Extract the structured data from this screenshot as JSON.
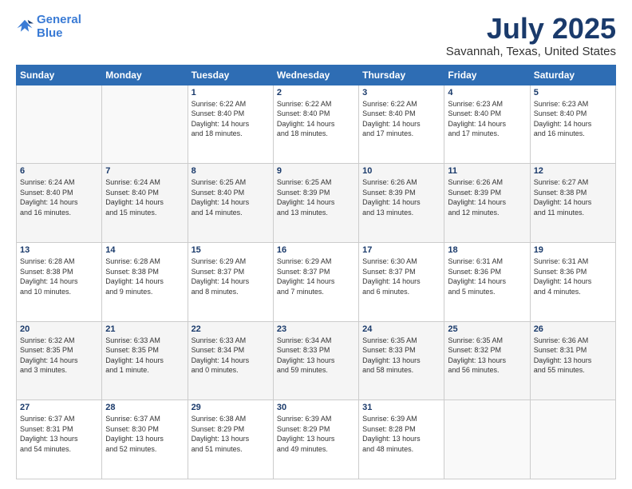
{
  "logo": {
    "line1": "General",
    "line2": "Blue"
  },
  "title": "July 2025",
  "subtitle": "Savannah, Texas, United States",
  "days_header": [
    "Sunday",
    "Monday",
    "Tuesday",
    "Wednesday",
    "Thursday",
    "Friday",
    "Saturday"
  ],
  "weeks": [
    [
      {
        "num": "",
        "info": ""
      },
      {
        "num": "",
        "info": ""
      },
      {
        "num": "1",
        "info": "Sunrise: 6:22 AM\nSunset: 8:40 PM\nDaylight: 14 hours\nand 18 minutes."
      },
      {
        "num": "2",
        "info": "Sunrise: 6:22 AM\nSunset: 8:40 PM\nDaylight: 14 hours\nand 18 minutes."
      },
      {
        "num": "3",
        "info": "Sunrise: 6:22 AM\nSunset: 8:40 PM\nDaylight: 14 hours\nand 17 minutes."
      },
      {
        "num": "4",
        "info": "Sunrise: 6:23 AM\nSunset: 8:40 PM\nDaylight: 14 hours\nand 17 minutes."
      },
      {
        "num": "5",
        "info": "Sunrise: 6:23 AM\nSunset: 8:40 PM\nDaylight: 14 hours\nand 16 minutes."
      }
    ],
    [
      {
        "num": "6",
        "info": "Sunrise: 6:24 AM\nSunset: 8:40 PM\nDaylight: 14 hours\nand 16 minutes."
      },
      {
        "num": "7",
        "info": "Sunrise: 6:24 AM\nSunset: 8:40 PM\nDaylight: 14 hours\nand 15 minutes."
      },
      {
        "num": "8",
        "info": "Sunrise: 6:25 AM\nSunset: 8:40 PM\nDaylight: 14 hours\nand 14 minutes."
      },
      {
        "num": "9",
        "info": "Sunrise: 6:25 AM\nSunset: 8:39 PM\nDaylight: 14 hours\nand 13 minutes."
      },
      {
        "num": "10",
        "info": "Sunrise: 6:26 AM\nSunset: 8:39 PM\nDaylight: 14 hours\nand 13 minutes."
      },
      {
        "num": "11",
        "info": "Sunrise: 6:26 AM\nSunset: 8:39 PM\nDaylight: 14 hours\nand 12 minutes."
      },
      {
        "num": "12",
        "info": "Sunrise: 6:27 AM\nSunset: 8:38 PM\nDaylight: 14 hours\nand 11 minutes."
      }
    ],
    [
      {
        "num": "13",
        "info": "Sunrise: 6:28 AM\nSunset: 8:38 PM\nDaylight: 14 hours\nand 10 minutes."
      },
      {
        "num": "14",
        "info": "Sunrise: 6:28 AM\nSunset: 8:38 PM\nDaylight: 14 hours\nand 9 minutes."
      },
      {
        "num": "15",
        "info": "Sunrise: 6:29 AM\nSunset: 8:37 PM\nDaylight: 14 hours\nand 8 minutes."
      },
      {
        "num": "16",
        "info": "Sunrise: 6:29 AM\nSunset: 8:37 PM\nDaylight: 14 hours\nand 7 minutes."
      },
      {
        "num": "17",
        "info": "Sunrise: 6:30 AM\nSunset: 8:37 PM\nDaylight: 14 hours\nand 6 minutes."
      },
      {
        "num": "18",
        "info": "Sunrise: 6:31 AM\nSunset: 8:36 PM\nDaylight: 14 hours\nand 5 minutes."
      },
      {
        "num": "19",
        "info": "Sunrise: 6:31 AM\nSunset: 8:36 PM\nDaylight: 14 hours\nand 4 minutes."
      }
    ],
    [
      {
        "num": "20",
        "info": "Sunrise: 6:32 AM\nSunset: 8:35 PM\nDaylight: 14 hours\nand 3 minutes."
      },
      {
        "num": "21",
        "info": "Sunrise: 6:33 AM\nSunset: 8:35 PM\nDaylight: 14 hours\nand 1 minute."
      },
      {
        "num": "22",
        "info": "Sunrise: 6:33 AM\nSunset: 8:34 PM\nDaylight: 14 hours\nand 0 minutes."
      },
      {
        "num": "23",
        "info": "Sunrise: 6:34 AM\nSunset: 8:33 PM\nDaylight: 13 hours\nand 59 minutes."
      },
      {
        "num": "24",
        "info": "Sunrise: 6:35 AM\nSunset: 8:33 PM\nDaylight: 13 hours\nand 58 minutes."
      },
      {
        "num": "25",
        "info": "Sunrise: 6:35 AM\nSunset: 8:32 PM\nDaylight: 13 hours\nand 56 minutes."
      },
      {
        "num": "26",
        "info": "Sunrise: 6:36 AM\nSunset: 8:31 PM\nDaylight: 13 hours\nand 55 minutes."
      }
    ],
    [
      {
        "num": "27",
        "info": "Sunrise: 6:37 AM\nSunset: 8:31 PM\nDaylight: 13 hours\nand 54 minutes."
      },
      {
        "num": "28",
        "info": "Sunrise: 6:37 AM\nSunset: 8:30 PM\nDaylight: 13 hours\nand 52 minutes."
      },
      {
        "num": "29",
        "info": "Sunrise: 6:38 AM\nSunset: 8:29 PM\nDaylight: 13 hours\nand 51 minutes."
      },
      {
        "num": "30",
        "info": "Sunrise: 6:39 AM\nSunset: 8:29 PM\nDaylight: 13 hours\nand 49 minutes."
      },
      {
        "num": "31",
        "info": "Sunrise: 6:39 AM\nSunset: 8:28 PM\nDaylight: 13 hours\nand 48 minutes."
      },
      {
        "num": "",
        "info": ""
      },
      {
        "num": "",
        "info": ""
      }
    ]
  ]
}
